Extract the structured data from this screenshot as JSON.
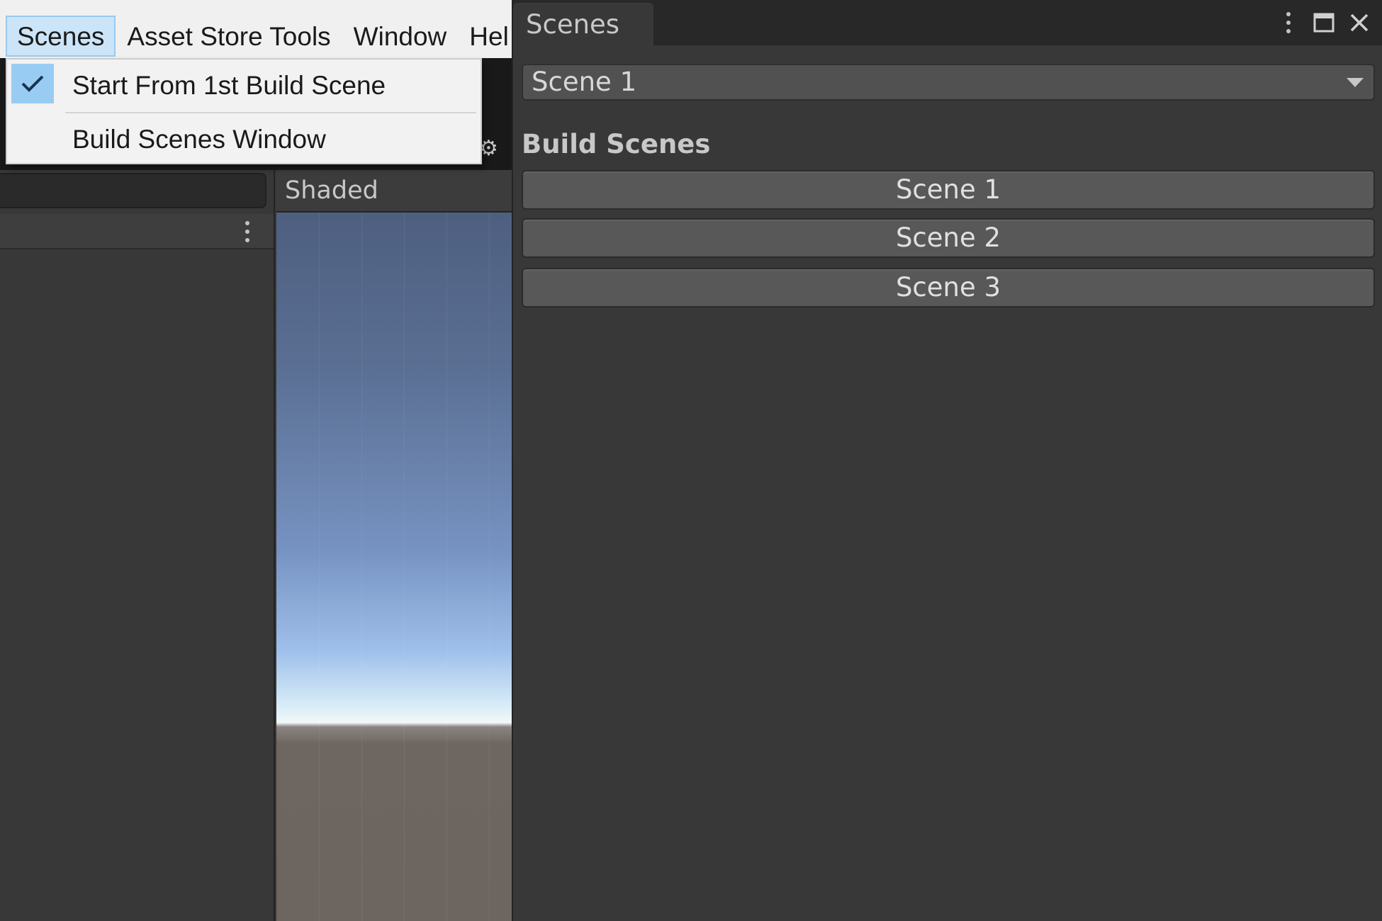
{
  "menubar": {
    "items": [
      {
        "label": "Scenes",
        "active": true
      },
      {
        "label": "Asset Store Tools",
        "active": false
      },
      {
        "label": "Window",
        "active": false
      },
      {
        "label": "Hel",
        "active": false
      }
    ]
  },
  "dropdown": {
    "items": [
      {
        "label": "Start From 1st Build Scene",
        "checked": true,
        "icon": "checkmark-icon"
      },
      {
        "label": "Build Scenes Window",
        "checked": false
      }
    ]
  },
  "scene_view": {
    "shading_mode": "Shaded"
  },
  "scenes_window": {
    "tab_title": "Scenes",
    "selected_scene": "Scene 1",
    "build_heading": "Build Scenes",
    "build_scenes": [
      "Scene 1",
      "Scene 2",
      "Scene 3"
    ]
  },
  "colors": {
    "editor_background": "#383838",
    "menu_highlight": "#cce4f7",
    "check_highlight": "#99ccf3",
    "button": "#585858"
  }
}
